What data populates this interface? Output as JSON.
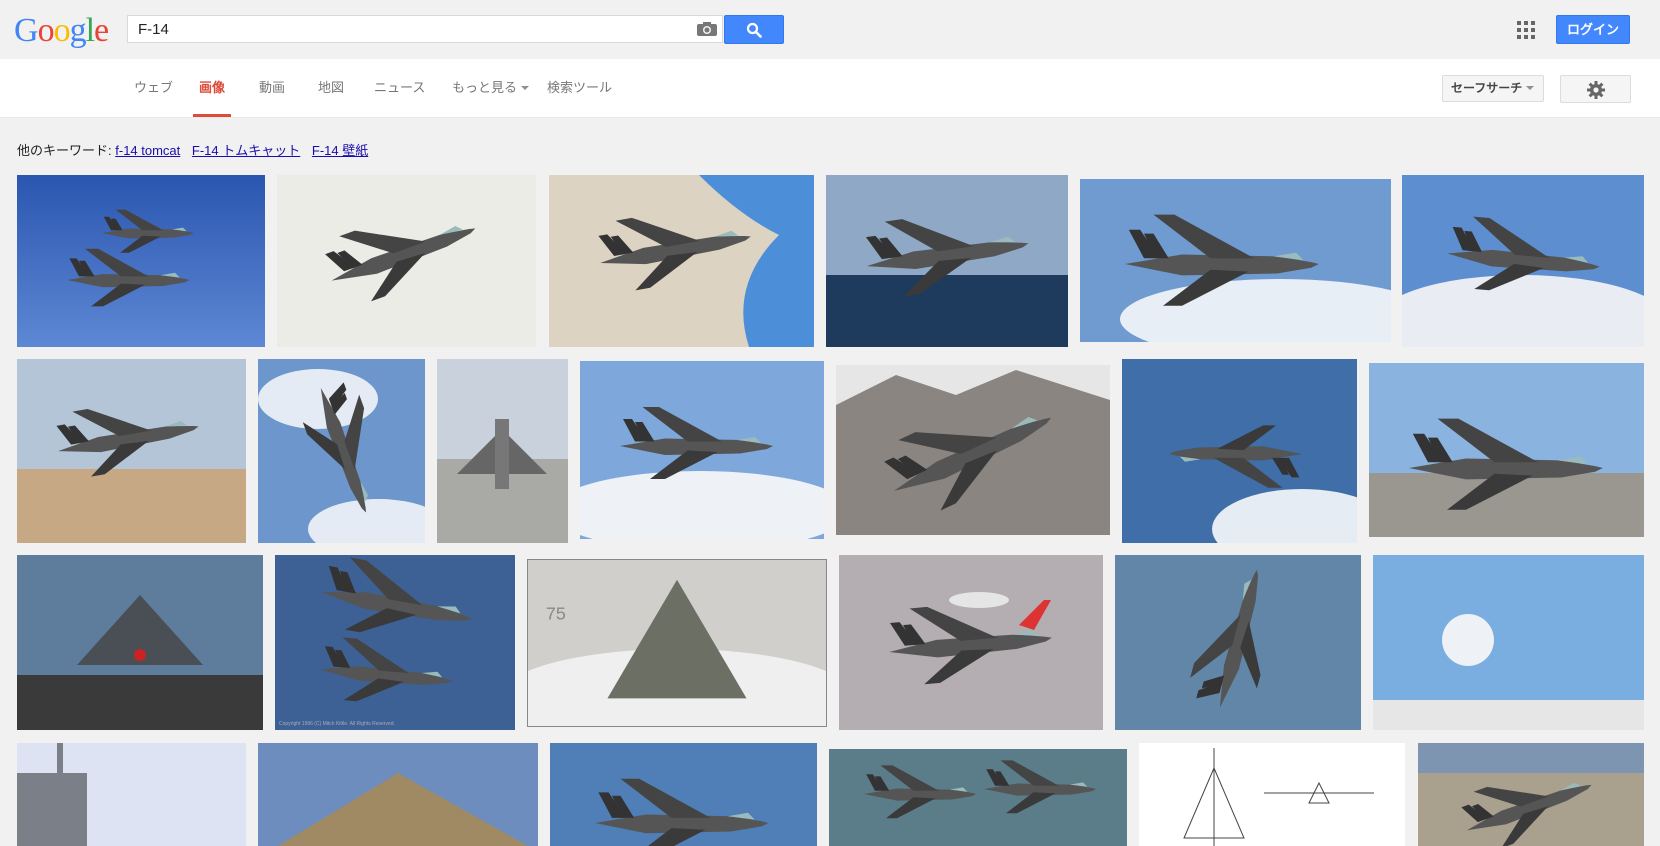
{
  "header": {
    "search_query": "F-14",
    "login_label": "ログイン"
  },
  "nav": {
    "tabs": [
      {
        "label": "ウェブ",
        "active": false
      },
      {
        "label": "画像",
        "active": true
      },
      {
        "label": "動画",
        "active": false
      },
      {
        "label": "地図",
        "active": false
      },
      {
        "label": "ニュース",
        "active": false
      },
      {
        "label": "もっと見る",
        "active": false,
        "dropdown": true
      },
      {
        "label": "検索ツール",
        "active": false
      }
    ],
    "safesearch_label": "セーフサーチ"
  },
  "related": {
    "prefix": "他のキーワード:",
    "links": [
      "f-14 tomcat",
      "F-14 トムキャット",
      "F-14 壁紙"
    ]
  },
  "results": {
    "watermark_text": "75",
    "copyright_text": "Copyright 1996 (C) Mitch Kittle. All Rights Reserved."
  },
  "colors": {
    "accent_red": "#dd4b39",
    "button_blue": "#4387fd",
    "link_blue": "#1a0dab"
  }
}
